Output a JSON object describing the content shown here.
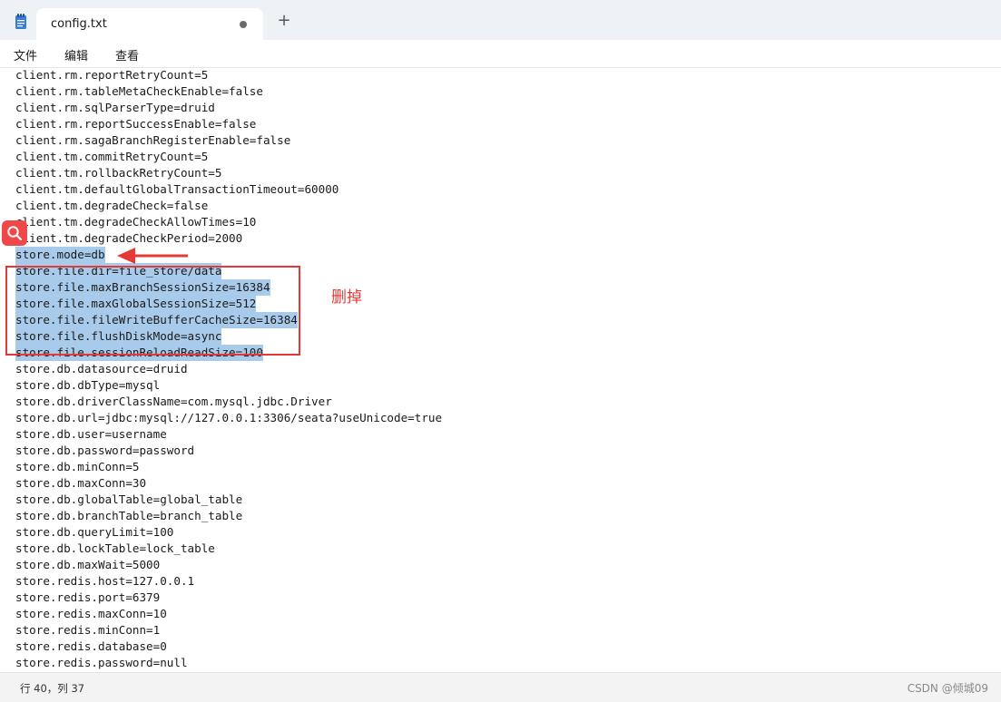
{
  "tab": {
    "title": "config.txt",
    "new_tab": "+"
  },
  "menu": {
    "items": [
      "文件",
      "编辑",
      "查看"
    ]
  },
  "lines": [
    "client.rm.reportRetryCount=5",
    "client.rm.tableMetaCheckEnable=false",
    "client.rm.sqlParserType=druid",
    "client.rm.reportSuccessEnable=false",
    "client.rm.sagaBranchRegisterEnable=false",
    "client.tm.commitRetryCount=5",
    "client.tm.rollbackRetryCount=5",
    "client.tm.defaultGlobalTransactionTimeout=60000",
    "client.tm.degradeCheck=false",
    "client.tm.degradeCheckAllowTimes=10",
    "client.tm.degradeCheckPeriod=2000",
    "store.mode=db",
    "store.file.dir=file_store/data",
    "store.file.maxBranchSessionSize=16384",
    "store.file.maxGlobalSessionSize=512",
    "store.file.fileWriteBufferCacheSize=16384",
    "store.file.flushDiskMode=async",
    "store.file.sessionReloadReadSize=100",
    "store.db.datasource=druid",
    "store.db.dbType=mysql",
    "store.db.driverClassName=com.mysql.jdbc.Driver",
    "store.db.url=jdbc:mysql://127.0.0.1:3306/seata?useUnicode=true",
    "store.db.user=username",
    "store.db.password=password",
    "store.db.minConn=5",
    "store.db.maxConn=30",
    "store.db.globalTable=global_table",
    "store.db.branchTable=branch_table",
    "store.db.queryLimit=100",
    "store.db.lockTable=lock_table",
    "store.db.maxWait=5000",
    "store.redis.host=127.0.0.1",
    "store.redis.port=6379",
    "store.redis.maxConn=10",
    "store.redis.minConn=1",
    "store.redis.database=0",
    "store.redis.password=null"
  ],
  "selected_lines": [
    11,
    12,
    13,
    14,
    15,
    16,
    17
  ],
  "annotation": {
    "note": "删掉",
    "color": "#e53935"
  },
  "status": {
    "position": "行 40，列 37"
  },
  "watermark": "CSDN @倾城09"
}
